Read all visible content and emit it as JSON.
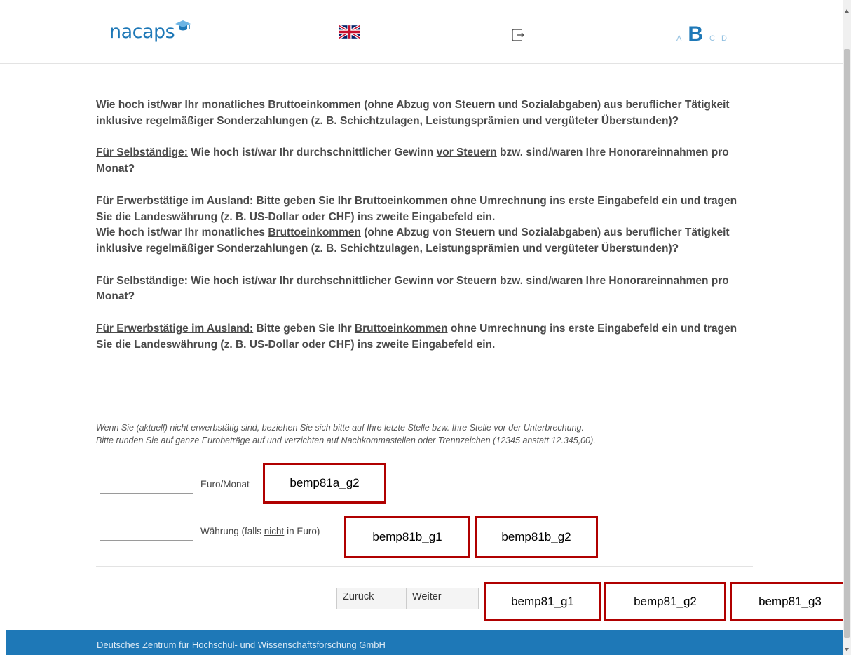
{
  "header": {
    "logo_text": "nacaps",
    "language_flag_icon": "uk-flag-icon",
    "exit_icon": "exit-icon",
    "versions": [
      "A",
      "B",
      "C",
      "D"
    ],
    "active_version": "B"
  },
  "question": {
    "p1_a": "Wie hoch ist/war Ihr monatliches ",
    "p1_u": "Bruttoeinkommen",
    "p1_b": " (ohne Abzug von Steuern und Sozialabgaben) aus beruflicher Tätigkeit inklusive regelmäßiger Sonderzahlungen (z. B. Schichtzulagen, Leistungsprämien und vergüteter Überstunden)?",
    "p2_u": "Für Selbständige:",
    "p2_a": " Wie hoch ist/war Ihr durchschnittlicher Gewinn ",
    "p2_u2": "vor Steuern",
    "p2_b": " bzw. sind/waren Ihre Honorareinnahmen pro Monat?",
    "p3_u": "Für Erwerbstätige im Ausland:",
    "p3_a": " Bitte geben Sie Ihr ",
    "p3_u2": "Bruttoeinkommen",
    "p3_b": " ohne Umrechnung ins erste Eingabefeld ein und tragen Sie die Landeswährung (z. B. US-Dollar oder CHF) ins zweite Eingabefeld ein."
  },
  "hint": {
    "line1": "Wenn Sie (aktuell) nicht erwerbstätig sind, beziehen Sie sich bitte auf Ihre letzte Stelle bzw. Ihre Stelle vor der Unterbrechung.",
    "line2": "Bitte runden Sie auf ganze Eurobeträge auf und verzichten auf Nachkommastellen oder Trennzeichen (12345 anstatt 12.345,00)."
  },
  "inputs": {
    "income": {
      "value": "",
      "label": "Euro/Monat"
    },
    "currency": {
      "value": "",
      "label_a": "Währung (falls ",
      "label_u": "nicht",
      "label_b": " in Euro)"
    }
  },
  "tags": {
    "t1": "bemp81a_g2",
    "t2": "bemp81b_g1",
    "t3": "bemp81b_g2",
    "t4": "bemp81_g1",
    "t5": "bemp81_g2",
    "t6": "bemp81_g3"
  },
  "nav": {
    "back": "Zurück",
    "next": "Weiter"
  },
  "footer": {
    "text": "Deutsches Zentrum für Hochschul- und Wissenschaftsforschung GmbH"
  },
  "colors": {
    "brand": "#1e78b7",
    "tag_border": "#b00000"
  }
}
